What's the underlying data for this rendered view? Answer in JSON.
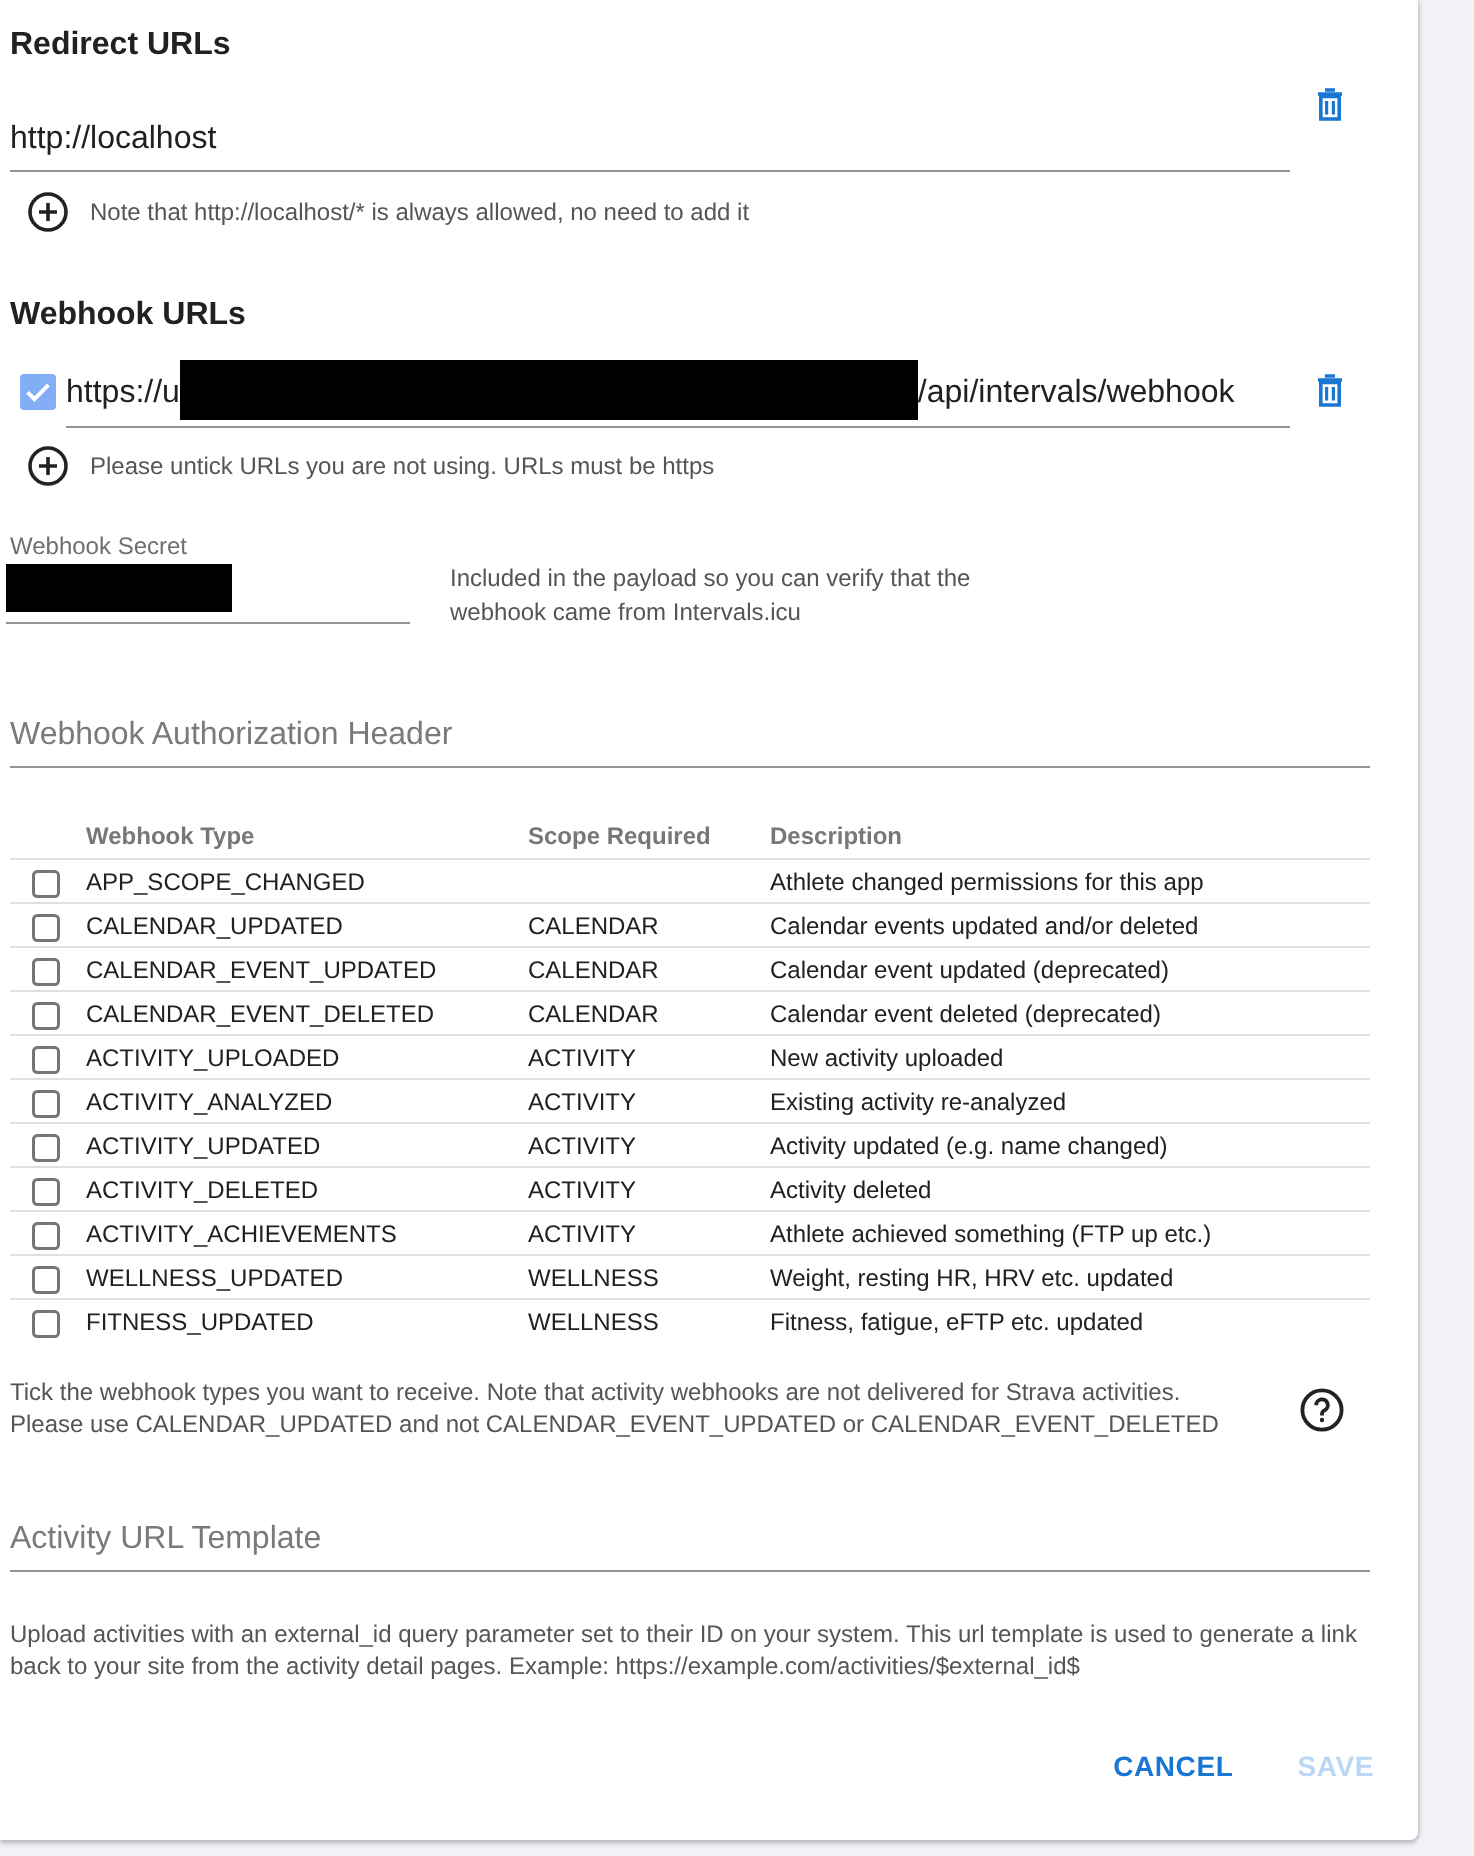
{
  "redirect_urls": {
    "heading": "Redirect URLs",
    "urls": [
      {
        "value": "http://localhost"
      }
    ],
    "note": "Note that http://localhost/* is always allowed, no need to add it"
  },
  "webhook_urls": {
    "heading": "Webhook URLs",
    "urls": [
      {
        "checked": true,
        "parts": [
          {
            "kind": "text",
            "text": "https://u"
          },
          {
            "kind": "redacted"
          },
          {
            "kind": "text",
            "text": "/api/intervals/webhook"
          }
        ]
      }
    ],
    "note": "Please untick URLs you are not using. URLs must be https"
  },
  "webhook_secret": {
    "label": "Webhook Secret",
    "value_redacted": true,
    "help": "Included in the payload so you can verify that the webhook came from Intervals.icu"
  },
  "authorization_header": {
    "placeholder": "Webhook Authorization Header"
  },
  "webhook_types": {
    "columns": [
      "Webhook Type",
      "Scope Required",
      "Description"
    ],
    "rows": [
      {
        "checked": false,
        "type": "APP_SCOPE_CHANGED",
        "description": "Athlete changed permissions for this app"
      },
      {
        "checked": false,
        "type": "CALENDAR_UPDATED",
        "scope": "CALENDAR",
        "description": "Calendar events updated and/or deleted"
      },
      {
        "checked": false,
        "type": "CALENDAR_EVENT_UPDATED",
        "scope": "CALENDAR",
        "description": "Calendar event updated (deprecated)"
      },
      {
        "checked": false,
        "type": "CALENDAR_EVENT_DELETED",
        "scope": "CALENDAR",
        "description": "Calendar event deleted (deprecated)"
      },
      {
        "checked": false,
        "type": "ACTIVITY_UPLOADED",
        "scope": "ACTIVITY",
        "description": "New activity uploaded"
      },
      {
        "checked": false,
        "type": "ACTIVITY_ANALYZED",
        "scope": "ACTIVITY",
        "description": "Existing activity re-analyzed"
      },
      {
        "checked": false,
        "type": "ACTIVITY_UPDATED",
        "scope": "ACTIVITY",
        "description": "Activity updated (e.g. name changed)"
      },
      {
        "checked": false,
        "type": "ACTIVITY_DELETED",
        "scope": "ACTIVITY",
        "description": "Activity deleted"
      },
      {
        "checked": false,
        "type": "ACTIVITY_ACHIEVEMENTS",
        "scope": "ACTIVITY",
        "description": "Athlete achieved something (FTP up etc.)"
      },
      {
        "checked": false,
        "type": "WELLNESS_UPDATED",
        "scope": "WELLNESS",
        "description": "Weight, resting HR, HRV etc. updated"
      },
      {
        "checked": false,
        "type": "FITNESS_UPDATED",
        "scope": "WELLNESS",
        "description": "Fitness, fatigue, eFTP etc. updated"
      }
    ],
    "note": "Tick the webhook types you want to receive. Note that activity webhooks are not delivered for Strava activities.\nPlease use CALENDAR_UPDATED and not CALENDAR_EVENT_UPDATED or CALENDAR_EVENT_DELETED"
  },
  "activity_url_template": {
    "placeholder": "Activity URL Template",
    "help": "Upload activities with an external_id query parameter set to their ID on your system. This url template is used to generate a link back to your site from the activity detail pages. Example: https://example.com/activities/$external_id$"
  },
  "buttons": [
    {
      "label": "CANCEL",
      "disabled": false
    },
    {
      "label": "SAVE",
      "disabled": true
    }
  ]
}
